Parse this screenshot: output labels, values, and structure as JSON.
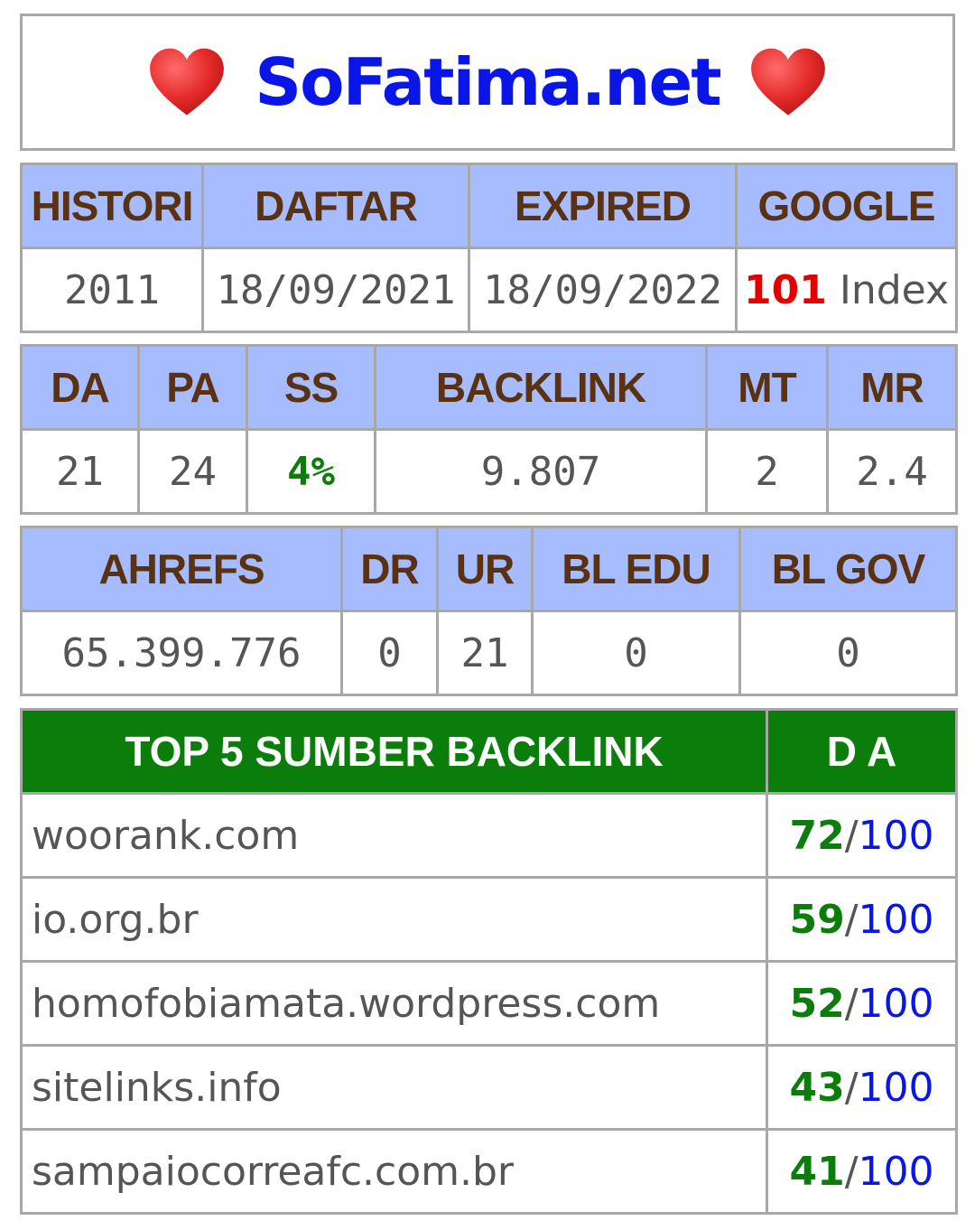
{
  "site": {
    "title": "SoFatima.net",
    "heart_icon": "heart-icon",
    "heart_color": "#e52b2b"
  },
  "history_table": {
    "headers": [
      "HISTORI",
      "DAFTAR",
      "EXPIRED",
      "GOOGLE"
    ],
    "values": {
      "histori": "2011",
      "daftar": "18/09/2021",
      "expired": "18/09/2022",
      "google_count": "101",
      "google_suffix": "Index"
    }
  },
  "moz_table": {
    "headers": [
      "DA",
      "PA",
      "SS",
      "BACKLINK",
      "MT",
      "MR"
    ],
    "values": [
      "21",
      "24",
      "4%",
      "9.807",
      "2",
      "2.4"
    ]
  },
  "ahrefs_table": {
    "headers": [
      "AHREFS",
      "DR",
      "UR",
      "BL EDU",
      "BL GOV"
    ],
    "values": [
      "65.399.776",
      "0",
      "21",
      "0",
      "0"
    ]
  },
  "top_backlinks": {
    "header_source": "TOP 5 SUMBER BACKLINK",
    "header_da": "D A",
    "separator": "/",
    "max": "100",
    "rows": [
      {
        "domain": "woorank.com",
        "da": "72"
      },
      {
        "domain": "io.org.br",
        "da": "59"
      },
      {
        "domain": "homofobiamata.wordpress.com",
        "da": "52"
      },
      {
        "domain": "sitelinks.info",
        "da": "43"
      },
      {
        "domain": "sampaiocorreafc.com.br",
        "da": "41"
      }
    ]
  },
  "colors": {
    "header_bg": "#a6bcff",
    "header_text": "#5a3212",
    "green_header_bg": "#0a7d0a",
    "title_blue": "#0a16e8",
    "accent_red": "#e30000",
    "accent_green": "#0a7d0a"
  }
}
